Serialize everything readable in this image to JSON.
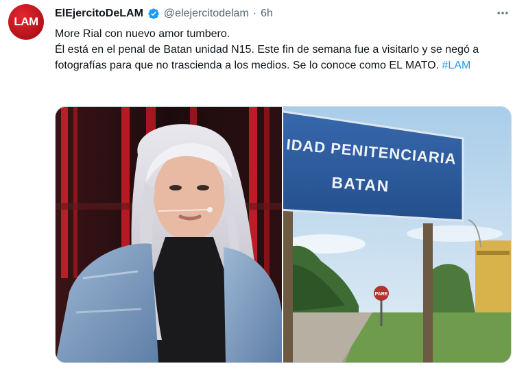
{
  "tweet": {
    "avatar_text": "LAM",
    "display_name": "ElEjercitoDeLAM",
    "handle": "@elejercitodelam",
    "separator": "·",
    "time": "6h",
    "more_icon": "more-horizontal-icon",
    "verified_icon": "verified-badge-icon",
    "text_lines": [
      "More Rial con nuevo amor tumbero.",
      "Él está en el penal de Batan unidad N15. Este fin de semana fue a visitarlo y se negó a fotografías para que no trascienda a los medios.  Se lo conoce como EL MATO."
    ],
    "hashtag": "#LAM",
    "sign": {
      "line1": "IDAD PENITENCIARIA",
      "line2": "BATAN"
    },
    "stop_sign_text": "PARE",
    "colors": {
      "accent": "#1d9bf0",
      "avatar": "#c8161e",
      "sign_blue": "#2c5a9e"
    }
  }
}
